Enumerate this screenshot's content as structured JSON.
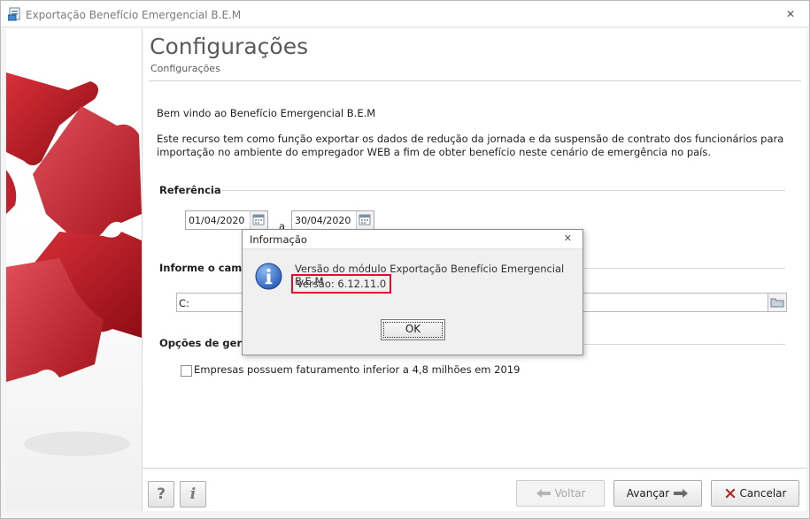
{
  "window": {
    "title": "Exportação Benefício Emergencial B.E.M",
    "close_glyph": "✕"
  },
  "header": {
    "title": "Configurações",
    "subtitle": "Configurações"
  },
  "content": {
    "welcome": "Bem vindo ao Benefício Emergencial B.E.M",
    "description": "Este recurso tem como função exportar os dados de redução da jornada e da suspensão de contrato dos funcionários para importação no ambiente do empregador WEB a fim de obter benefício neste cenário de emergência no país."
  },
  "referencia": {
    "label": "Referência",
    "date_from": "01/04/2020",
    "separator": "a",
    "date_to": "30/04/2020"
  },
  "caminho": {
    "label": "Informe o caminho",
    "path": "C:"
  },
  "opcoes": {
    "label": "Opções de geração",
    "checkbox_label": "Empresas possuem faturamento inferior a 4,8 milhões em 2019",
    "checked": false
  },
  "footer": {
    "help_label": "?",
    "info_label": "i",
    "back_label": "Voltar",
    "next_label": "Avançar",
    "cancel_label": "Cancelar"
  },
  "dialog": {
    "title": "Informação",
    "close_glyph": "✕",
    "message": "Versão do módulo Exportação Benefício Emergencial B.E.M",
    "version": "Versão: 6.12.11.0",
    "ok_label": "OK"
  },
  "colors": {
    "highlight_border": "#e0102a",
    "puzzle_red": "#b3141c",
    "info_icon_blue": "#1f56b8"
  }
}
